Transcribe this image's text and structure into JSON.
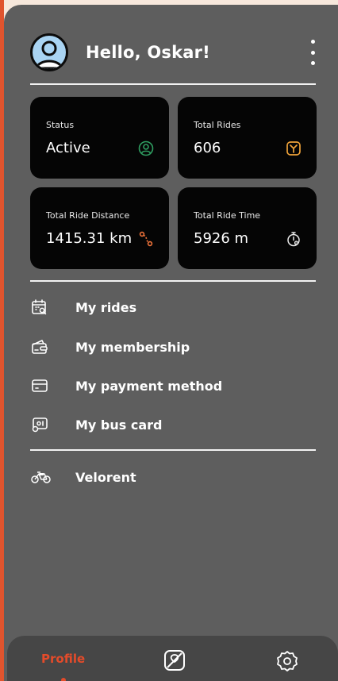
{
  "header": {
    "greeting": "Hello, Oskar!",
    "avatar_icon": "user-avatar-icon",
    "menu_icon": "more-vertical-icon"
  },
  "stats": [
    {
      "label": "Status",
      "value": "Active",
      "icon": "user-circle-icon",
      "icon_color": "#2f9e61"
    },
    {
      "label": "Total Rides",
      "value": "606",
      "icon": "ride-route-icon",
      "icon_color": "#f0a33a"
    },
    {
      "label": "Total Ride Distance",
      "value": "1415.31 km",
      "icon": "distance-icon",
      "icon_color": "#f0733a"
    },
    {
      "label": "Total Ride Time",
      "value": "5926 m",
      "icon": "stopwatch-icon",
      "icon_color": "#e8e8e8"
    }
  ],
  "menu": [
    {
      "label": "My rides",
      "icon": "calendar-search-icon"
    },
    {
      "label": "My membership",
      "icon": "wallet-icon"
    },
    {
      "label": "My payment method",
      "icon": "credit-card-icon"
    },
    {
      "label": "My bus card",
      "icon": "bus-card-icon"
    }
  ],
  "secondary_menu": [
    {
      "label": "Velorent",
      "icon": "bicycle-icon"
    }
  ],
  "nav": {
    "profile_label": "Profile",
    "map_icon": "map-icon",
    "settings_icon": "gear-icon",
    "active_color": "#e44b2a"
  },
  "colors": {
    "background": "#5e5e5e",
    "card": "#050505",
    "accent": "#e44b2a"
  }
}
